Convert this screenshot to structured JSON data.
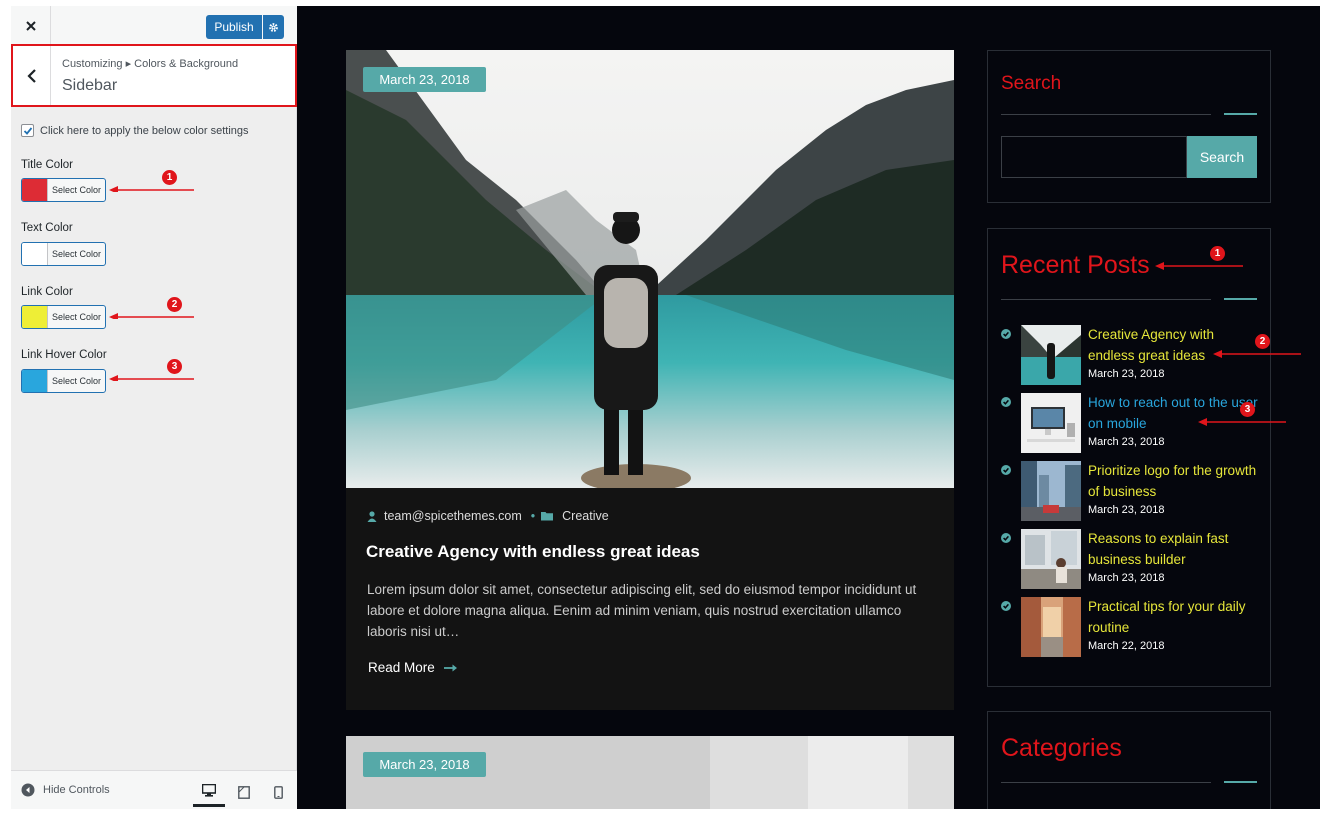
{
  "customizer": {
    "publish_label": "Publish",
    "breadcrumb": "Customizing ▸ Colors & Background",
    "section_title": "Sidebar",
    "apply_label": "Click here to apply the below color settings",
    "controls": [
      {
        "label": "Title Color",
        "button": "Select Color",
        "color": "#dd2c35",
        "annotation": "1"
      },
      {
        "label": "Text Color",
        "button": "Select Color",
        "color": "#ffffff",
        "annotation": ""
      },
      {
        "label": "Link Color",
        "button": "Select Color",
        "color": "#eeee36",
        "annotation": "2"
      },
      {
        "label": "Link Hover Color",
        "button": "Select Color",
        "color": "#29a6dd",
        "annotation": "3"
      }
    ],
    "hide_controls_label": "Hide Controls"
  },
  "post": {
    "date": "March 23, 2018",
    "author": "team@spicethemes.com",
    "category": "Creative",
    "title": "Creative Agency with endless great ideas",
    "excerpt": "Lorem ipsum dolor sit amet, consectetur adipiscing elit, sed do eiusmod tempor incididunt ut labore et dolore magna aliqua. Eenim ad minim veniam, quis nostrud exercitation ullamco laboris nisi ut…",
    "read_more": "Read More"
  },
  "post2": {
    "date": "March 23, 2018"
  },
  "sidebar": {
    "search": {
      "title": "Search",
      "button": "Search"
    },
    "recent_posts": {
      "title": "Recent Posts",
      "title_annotation": "1",
      "items": [
        {
          "title": "Creative Agency with endless great ideas",
          "date": "March 23, 2018",
          "annotation": "2",
          "hover": false
        },
        {
          "title": "How to reach out to the user on mobile",
          "date": "March 23, 2018",
          "annotation": "3",
          "hover": true
        },
        {
          "title": "Prioritize logo for the growth of business",
          "date": "March 23, 2018",
          "annotation": "",
          "hover": false
        },
        {
          "title": "Reasons to explain fast business builder",
          "date": "March 23, 2018",
          "annotation": "",
          "hover": false
        },
        {
          "title": "Practical tips for your daily routine",
          "date": "March 22, 2018",
          "annotation": "",
          "hover": false
        }
      ]
    },
    "categories": {
      "title": "Categories"
    }
  },
  "colors": {
    "title_red": "#e0151b",
    "link_yellow": "#e6e63a",
    "link_hover_blue": "#29a6dd",
    "accent_teal": "#56a9a8",
    "wp_blue": "#2271b1"
  }
}
